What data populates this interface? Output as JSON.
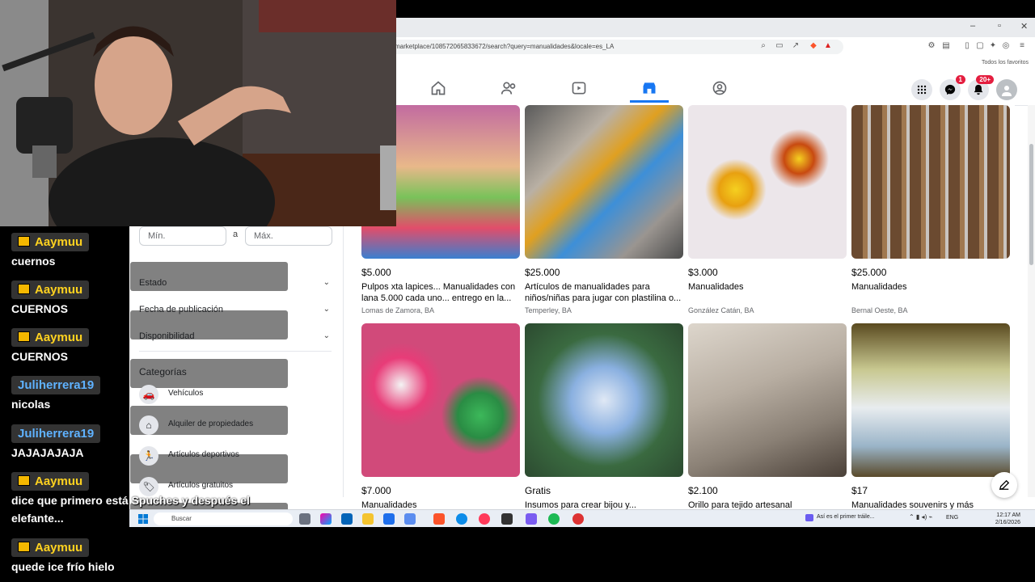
{
  "browser": {
    "url": "marketplace/108572065833672/search?query=manualidades&locale=es_LA",
    "favorites_label": "Todos los favoritos",
    "notif_badge": "20+",
    "messenger_badge": "1"
  },
  "sidebar": {
    "price_min_placeholder": "Mín.",
    "price_sep": "a",
    "price_max_placeholder": "Máx.",
    "filters": [
      "Estado",
      "Fecha de publicación",
      "Disponibilidad"
    ],
    "categories_heading": "Categorías",
    "categories": [
      {
        "label": "Vehículos",
        "icon": "car-icon"
      },
      {
        "label": "Alquiler de propiedades",
        "icon": "house-icon"
      },
      {
        "label": "Artículos deportivos",
        "icon": "running-icon"
      },
      {
        "label": "Artículos gratuitos",
        "icon": "tag-icon"
      }
    ]
  },
  "listings": [
    {
      "price": "$5.000",
      "title": "Pulpos xta lapices... Manualidades con lana 5.000 cada uno... entrego en la...",
      "location": "Lomas de Zamora, BA"
    },
    {
      "price": "$25.000",
      "title": "Artículos de manualidades para niños/niñas para jugar con plastilina o...",
      "location": "Temperley, BA"
    },
    {
      "price": "$3.000",
      "title": "Manualidades",
      "location": "González Catán, BA"
    },
    {
      "price": "$25.000",
      "title": "Manualidades",
      "location": "Bernal Oeste, BA"
    },
    {
      "price": "$7.000",
      "title": "Manualidades",
      "location": ""
    },
    {
      "price": "Gratis",
      "title": "Insumos para crear bijou y...",
      "location": ""
    },
    {
      "price": "$2.100",
      "title": "Orillo para tejido artesanal",
      "location": ""
    },
    {
      "price": "$17",
      "title": "Manualidades souvenirs y más",
      "location": ""
    }
  ],
  "taskbar": {
    "search_placeholder": "Buscar",
    "news": "Así es el primer tráile...",
    "lang": "ENG",
    "time": "12:17 AM",
    "date": "2/16/2026"
  },
  "chat": [
    {
      "user": "Aaymuu",
      "badge": "crown",
      "text": "cuernos"
    },
    {
      "user": "Aaymuu",
      "badge": "crown",
      "text": "CUERNOS"
    },
    {
      "user": "Aaymuu",
      "badge": "crown",
      "text": "CUERNOS"
    },
    {
      "user": "Juliherrera19",
      "badge": "",
      "text": "nicolas"
    },
    {
      "user": "Juliherrera19",
      "badge": "",
      "text": "JAJAJAJAJA"
    },
    {
      "user": "Aaymuu",
      "badge": "crown",
      "text": "dice que primero está Spuches y después el",
      "text2": "elefante..."
    },
    {
      "user": "Aaymuu",
      "badge": "crown",
      "text": "quede ice frío hielo"
    }
  ],
  "colors": {
    "fb_blue": "#1877f2",
    "chat_gold": "#ffd21f",
    "chat_blue": "#5fb2ff"
  }
}
